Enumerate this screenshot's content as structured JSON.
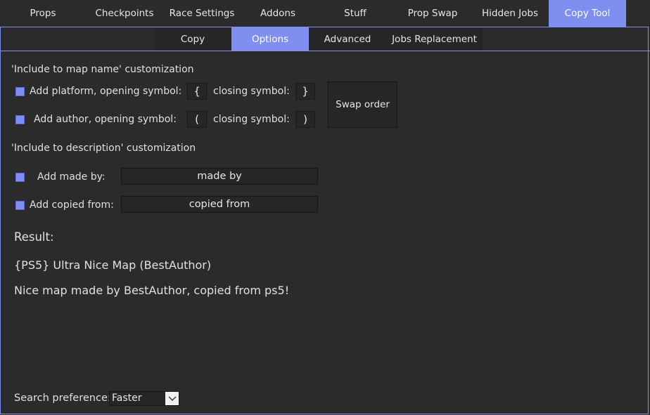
{
  "top_tabs": [
    "Props",
    "Checkpoints",
    "Race Settings",
    "Addons",
    "Stuff",
    "Prop Swap",
    "Hidden Jobs",
    "Copy Tool"
  ],
  "active_top_tab": "Copy Tool",
  "sub_tabs": [
    "Copy",
    "Options",
    "Advanced",
    "Jobs Replacement"
  ],
  "active_sub_tab": "Options",
  "map_name_section": {
    "heading": "'Include to map name' customization",
    "platform_label": "Add platform, opening symbol:",
    "platform_open": "{",
    "platform_closing_label": "closing symbol:",
    "platform_close": "}",
    "author_label": "Add author, opening symbol:",
    "author_open": "(",
    "author_closing_label": "closing symbol:",
    "author_close": ")",
    "swap_button": "Swap order"
  },
  "description_section": {
    "heading": "'Include to description' customization",
    "made_by_label": "Add made by:",
    "made_by_value": "made by",
    "copied_from_label": "Add copied from:",
    "copied_from_value": "copied from"
  },
  "result": {
    "label": "Result:",
    "map_name": "{PS5} Ultra Nice Map (BestAuthor)",
    "description": "Nice map  made by BestAuthor, copied from ps5!"
  },
  "search_preference": {
    "label": "Search preference:",
    "value": "Faster"
  },
  "colors": {
    "accent": "#7f8ff0",
    "background": "#2b2b2b",
    "field": "#262626"
  }
}
